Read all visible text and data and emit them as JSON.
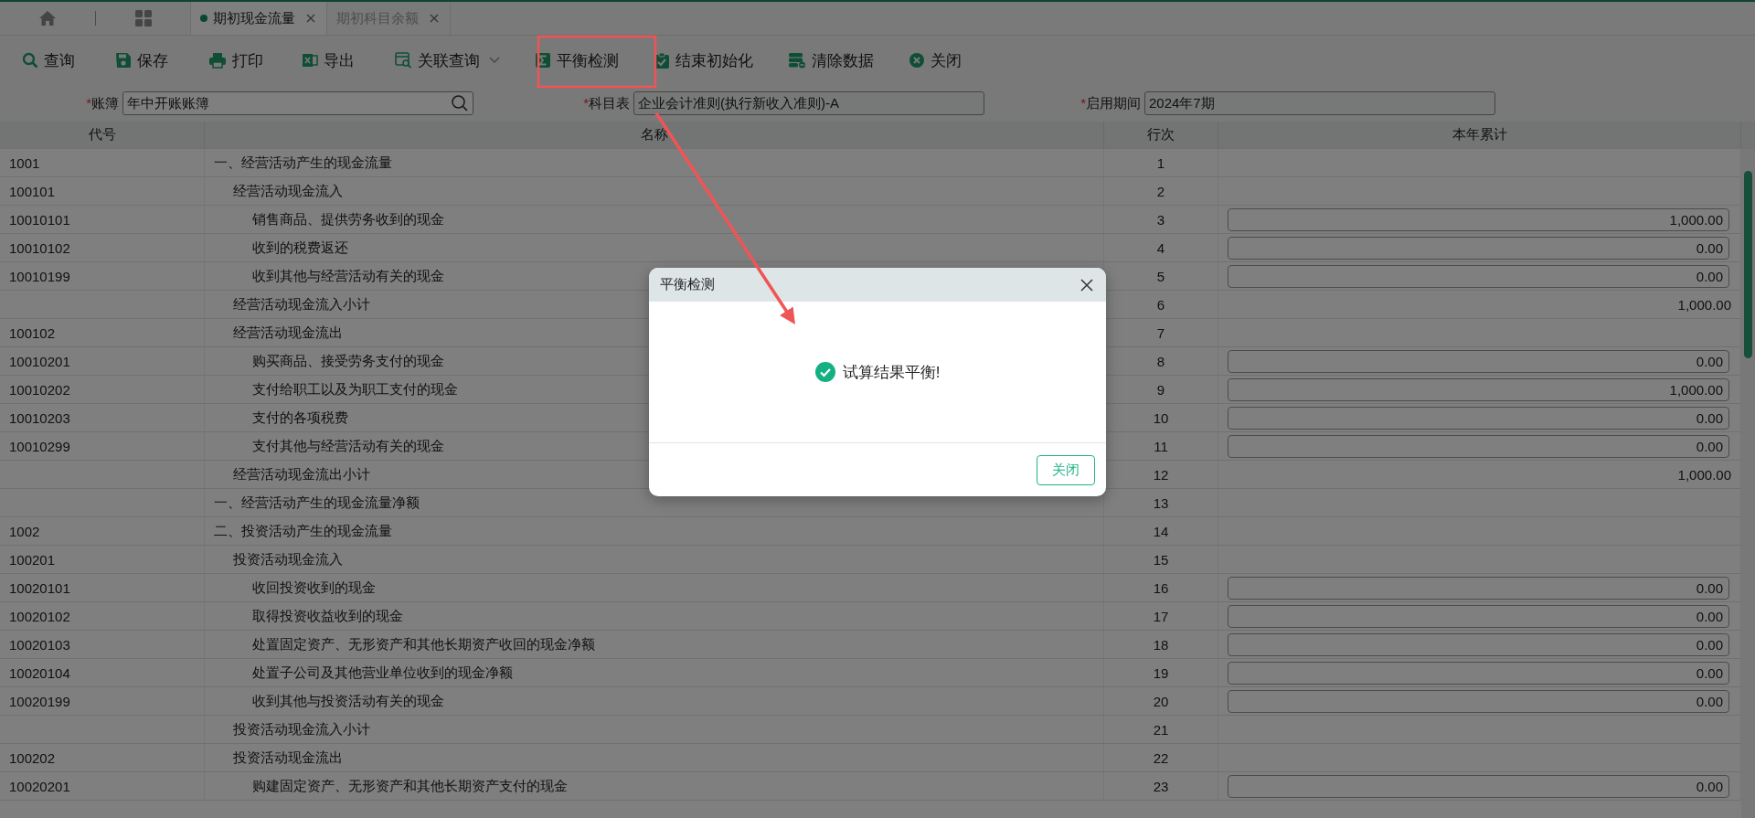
{
  "tabs": [
    {
      "label": "期初现金流量",
      "selected": true
    },
    {
      "label": "期初科目余额",
      "selected": false
    }
  ],
  "toolbar": [
    {
      "label": "查询",
      "dropdown": false
    },
    {
      "label": "保存",
      "dropdown": false
    },
    {
      "label": "打印",
      "dropdown": false
    },
    {
      "label": "导出",
      "dropdown": false
    },
    {
      "label": "关联查询",
      "dropdown": true
    },
    {
      "label": "平衡检测",
      "dropdown": false
    },
    {
      "label": "结束初始化",
      "dropdown": false
    },
    {
      "label": "清除数据",
      "dropdown": false
    },
    {
      "label": "关闭",
      "dropdown": false
    }
  ],
  "filters": [
    {
      "required_mark": "*",
      "label": "账簿",
      "value": "年中开账账簿",
      "searchable": true
    },
    {
      "required_mark": "*",
      "label": "科目表",
      "value": "企业会计准则(执行新收入准则)-A",
      "searchable": false
    },
    {
      "required_mark": "*",
      "label": "启用期间",
      "value": "2024年7期",
      "searchable": false
    }
  ],
  "table": {
    "columns": [
      "代号",
      "名称",
      "行次",
      "本年累计"
    ],
    "rows": [
      {
        "code": "1001",
        "name": "一、经营活动产生的现金流量",
        "line": "1",
        "children": [
          {
            "code": "100101",
            "name": "经营活动现金流入",
            "line": "2",
            "children": [
              {
                "code": "10010101",
                "name": "销售商品、提供劳务收到的现金",
                "line": "3",
                "kind": "input",
                "amount": "1,000.00"
              },
              {
                "code": "10010102",
                "name": "收到的税费返还",
                "line": "4",
                "kind": "input",
                "amount": "0.00"
              },
              {
                "code": "10010199",
                "name": "收到其他与经营活动有关的现金",
                "line": "5",
                "kind": "input",
                "amount": "0.00"
              }
            ]
          },
          {
            "name": "经营活动现金流入小计",
            "line": "6",
            "kind": "total",
            "amount": "1,000.00"
          },
          {
            "code": "100102",
            "name": "经营活动现金流出",
            "line": "7",
            "children": [
              {
                "code": "10010201",
                "name": "购买商品、接受劳务支付的现金",
                "line": "8",
                "kind": "input",
                "amount": "0.00"
              },
              {
                "code": "10010202",
                "name": "支付给职工以及为职工支付的现金",
                "line": "9",
                "kind": "input",
                "amount": "1,000.00"
              },
              {
                "code": "10010203",
                "name": "支付的各项税费",
                "line": "10",
                "kind": "input",
                "amount": "0.00"
              },
              {
                "code": "10010299",
                "name": "支付其他与经营活动有关的现金",
                "line": "11",
                "kind": "input",
                "amount": "0.00"
              }
            ]
          },
          {
            "name": "经营活动现金流出小计",
            "line": "12",
            "kind": "total",
            "amount": "1,000.00"
          }
        ]
      },
      {
        "name": "一、经营活动产生的现金流量净额",
        "line": "13"
      },
      {
        "code": "1002",
        "name": "二、投资活动产生的现金流量",
        "line": "14",
        "children": [
          {
            "code": "100201",
            "name": "投资活动现金流入",
            "line": "15",
            "children": [
              {
                "code": "10020101",
                "name": "收回投资收到的现金",
                "line": "16",
                "kind": "input",
                "amount": "0.00"
              },
              {
                "code": "10020102",
                "name": "取得投资收益收到的现金",
                "line": "17",
                "kind": "input",
                "amount": "0.00"
              },
              {
                "code": "10020103",
                "name": "处置固定资产、无形资产和其他长期资产收回的现金净额",
                "line": "18",
                "kind": "input",
                "amount": "0.00"
              },
              {
                "code": "10020104",
                "name": "处置子公司及其他营业单位收到的现金净额",
                "line": "19",
                "kind": "input",
                "amount": "0.00"
              },
              {
                "code": "10020199",
                "name": "收到其他与投资活动有关的现金",
                "line": "20",
                "kind": "input",
                "amount": "0.00"
              }
            ]
          },
          {
            "name": "投资活动现金流入小计",
            "line": "21"
          },
          {
            "code": "100202",
            "name": "投资活动现金流出",
            "line": "22",
            "children": [
              {
                "code": "10020201",
                "name": "购建固定资产、无形资产和其他长期资产支付的现金",
                "line": "23",
                "kind": "input",
                "amount": "0.00"
              }
            ]
          }
        ]
      }
    ]
  },
  "dialog": {
    "title": "平衡检测",
    "message": "试算结果平衡!",
    "button": "关闭"
  }
}
